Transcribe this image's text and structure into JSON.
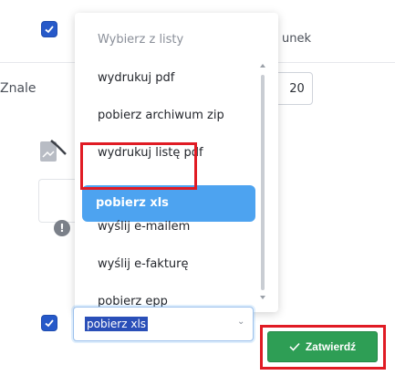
{
  "background": {
    "column_header_fragment": "unek",
    "found_label_fragment": "Znale",
    "page_size_value": "20",
    "info_icon_glyph": "!",
    "colors": {
      "checkbox": "#2659c9",
      "confirm": "#2e9e55",
      "highlight": "#4da3f0",
      "annotation": "#e01b24"
    }
  },
  "dropdown": {
    "header": "Wybierz z listy",
    "items": [
      "wydrukuj pdf",
      "pobierz archiwum zip",
      "wydrukuj listę pdf",
      "pobierz xls",
      "wyślij e-mailem",
      "wyślij e-fakturę",
      "pobierz epp"
    ],
    "selected_index": 3
  },
  "action_select": {
    "value": "pobierz xls",
    "chevron_icon": "chevron-down-icon"
  },
  "confirm_button": {
    "icon": "checkmark-icon",
    "label": "Zatwierdź"
  }
}
